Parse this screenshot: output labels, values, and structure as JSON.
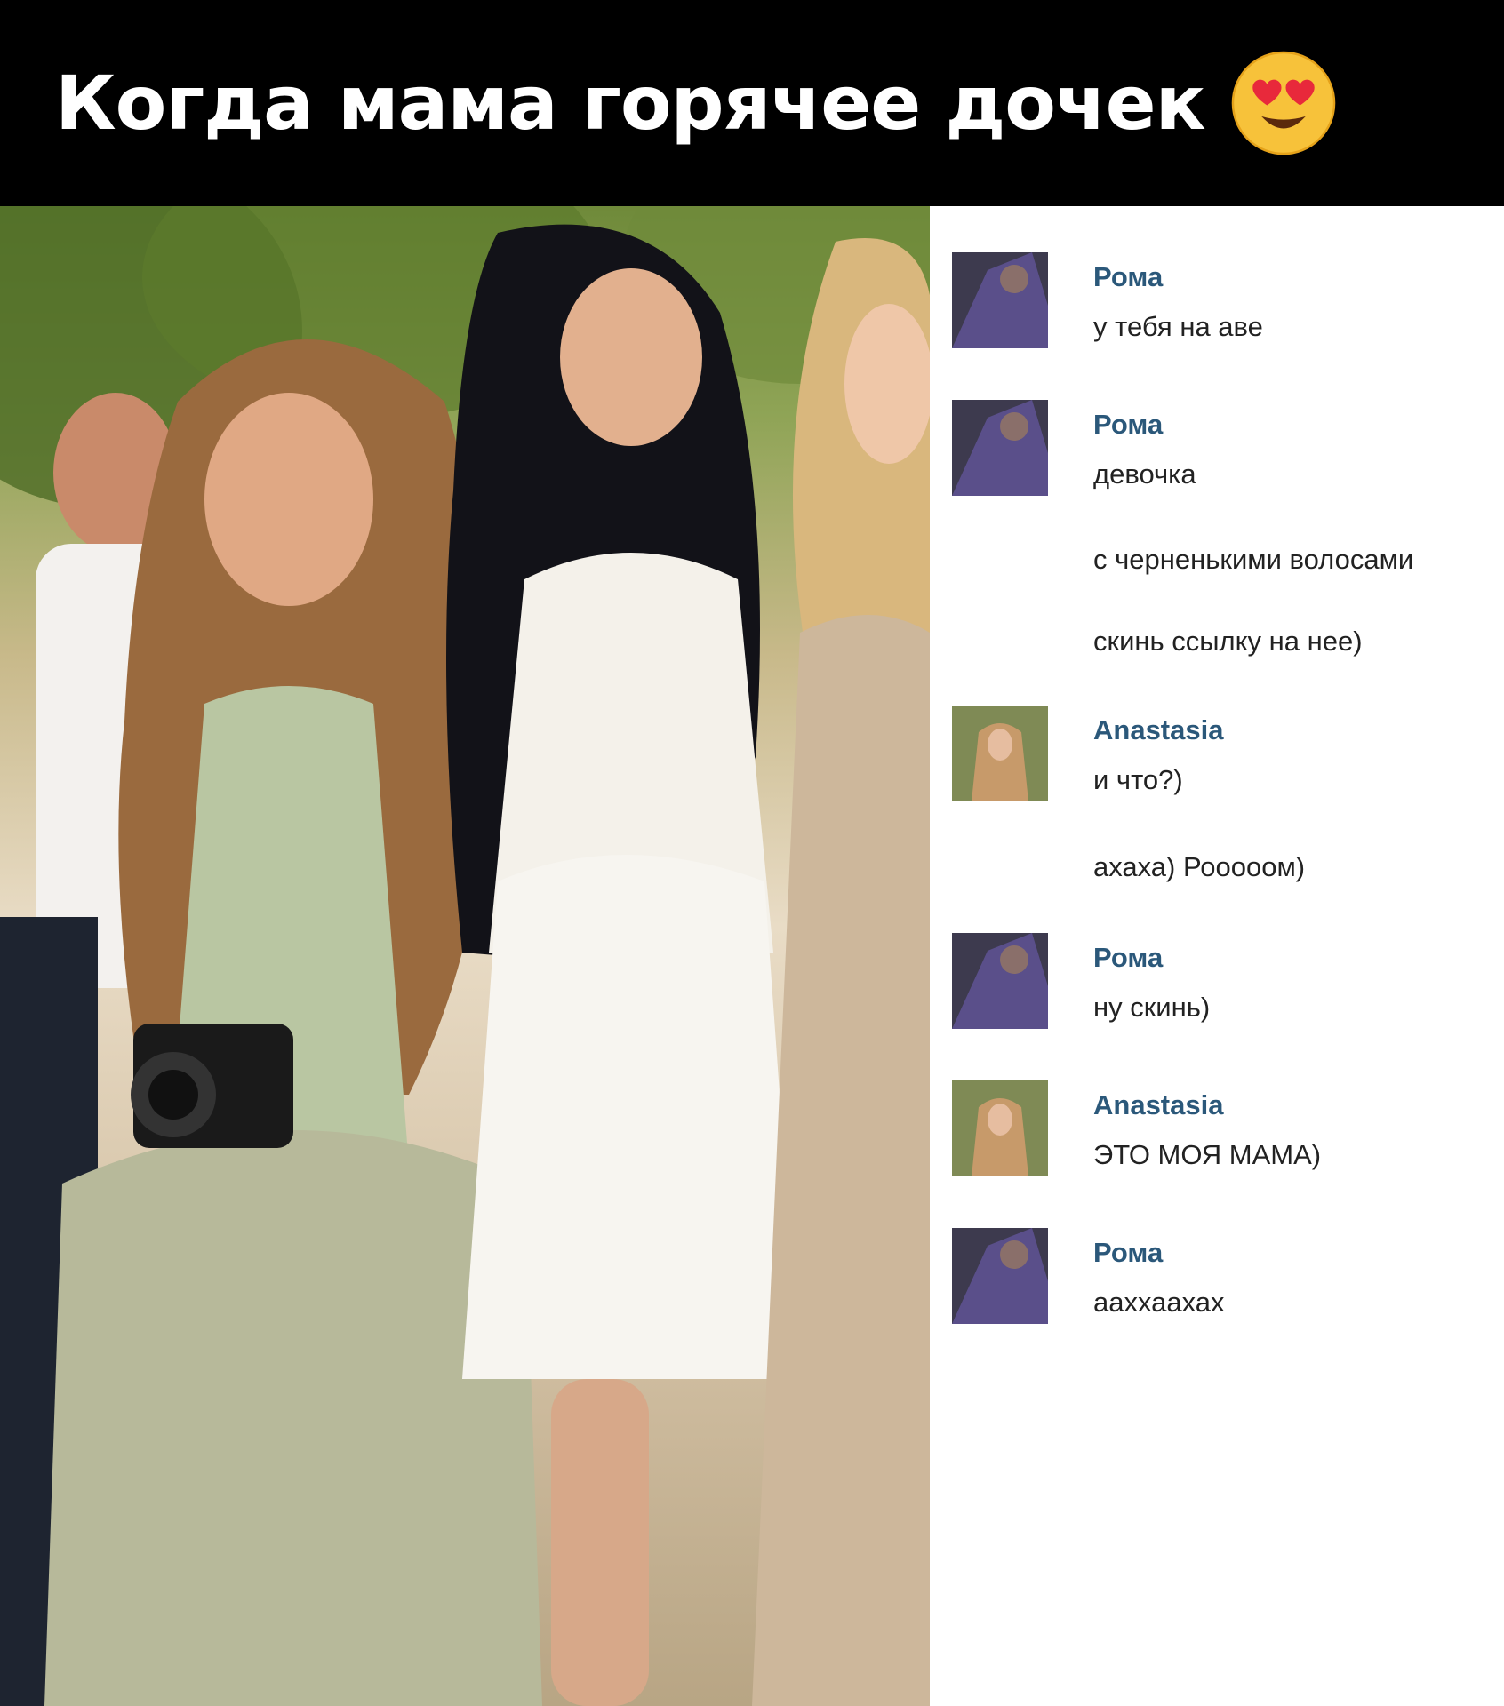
{
  "banner": {
    "title": "Когда мама горячее дочек",
    "emoji_icon": "heart-eyes-emoji-icon"
  },
  "photo": {
    "kind": "photograph"
  },
  "chat": {
    "author_color": "#2b587a",
    "messages": [
      {
        "author": "Рома",
        "avatar": "roma-avatar",
        "lines": [
          "у тебя на аве"
        ]
      },
      {
        "author": "Рома",
        "avatar": "roma-avatar",
        "lines": [
          "девочка",
          "с черненькими волосами",
          "скинь ссылку на нее)"
        ]
      },
      {
        "author": "Anastasia",
        "avatar": "anastasia-avatar",
        "lines": [
          "и что?)",
          "ахаха) Рооооом)"
        ]
      },
      {
        "author": "Рома",
        "avatar": "roma-avatar",
        "lines": [
          "ну скинь)"
        ]
      },
      {
        "author": "Anastasia",
        "avatar": "anastasia-avatar",
        "lines": [
          "ЭТО МОЯ МАМА)"
        ]
      },
      {
        "author": "Рома",
        "avatar": "roma-avatar",
        "lines": [
          "ааххаахах"
        ]
      }
    ]
  }
}
